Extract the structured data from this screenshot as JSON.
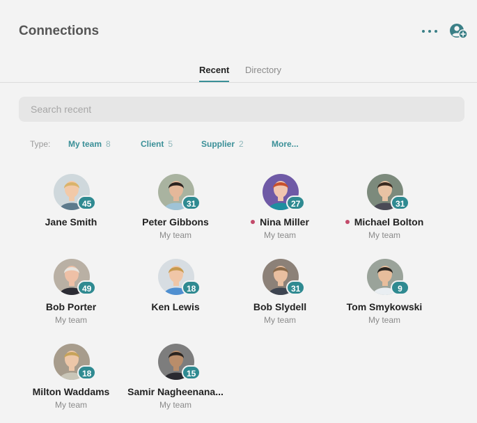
{
  "header": {
    "title": "Connections",
    "icons": [
      "more-horizontal-icon",
      "add-user-icon"
    ]
  },
  "tabs": [
    {
      "label": "Recent",
      "active": true
    },
    {
      "label": "Directory",
      "active": false
    }
  ],
  "search": {
    "placeholder": "Search recent",
    "value": ""
  },
  "filters": {
    "label": "Type:",
    "items": [
      {
        "name": "My team",
        "count": "8"
      },
      {
        "name": "Client",
        "count": "5"
      },
      {
        "name": "Supplier",
        "count": "2"
      },
      {
        "name": "More...",
        "count": ""
      }
    ]
  },
  "colors": {
    "accent": "#2f8a91",
    "presence_dot": "#c24a6a",
    "background": "#f3f3f3"
  },
  "people": [
    {
      "name": "Jane Smith",
      "role": "",
      "count": "45",
      "online": false
    },
    {
      "name": "Peter Gibbons",
      "role": "My team",
      "count": "31",
      "online": false
    },
    {
      "name": "Nina Miller",
      "role": "My team",
      "count": "27",
      "online": true
    },
    {
      "name": "Michael Bolton",
      "role": "My team",
      "count": "31",
      "online": true
    },
    {
      "name": "Bob Porter",
      "role": "My team",
      "count": "49",
      "online": false
    },
    {
      "name": "Ken Lewis",
      "role": "",
      "count": "18",
      "online": false
    },
    {
      "name": "Bob Slydell",
      "role": "My team",
      "count": "31",
      "online": false
    },
    {
      "name": "Tom Smykowski",
      "role": "My team",
      "count": "9",
      "online": false
    },
    {
      "name": "Milton Waddams",
      "role": "My team",
      "count": "18",
      "online": false
    },
    {
      "name": "Samir Nagheenana...",
      "role": "My team",
      "count": "15",
      "online": false
    }
  ]
}
